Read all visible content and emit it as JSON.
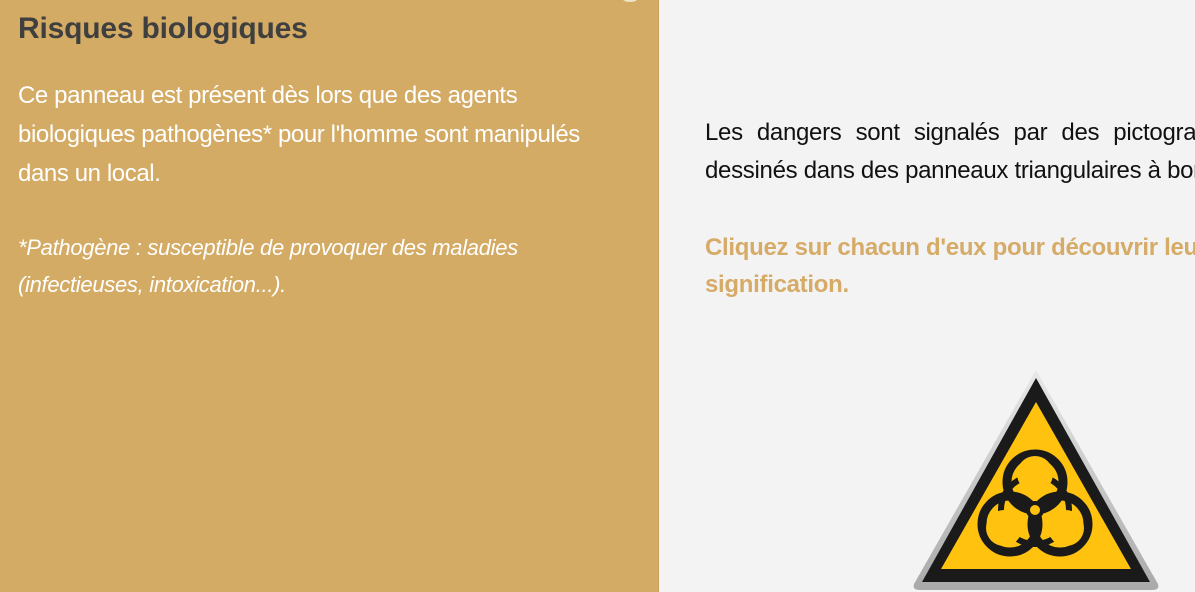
{
  "left_panel": {
    "title": "Risques biologiques",
    "description": "Ce panneau est présent dès lors que des agents biologiques pathogènes* pour l'homme sont manipulés dans un local.",
    "note": "*Pathogène : susceptible de provoquer des maladies (infectieuses, intoxication...).",
    "background_color": "#d3ab64"
  },
  "main": {
    "intro_text": "Les dangers sont signalés par des pictogrammes noirs dessinés dans des panneaux triangulaires à bord noir.",
    "instruction": "Cliquez sur chacun d'eux pour découvrir leur signification.",
    "accent_color": "#d6ab68"
  },
  "pictograms": [
    {
      "icon": "biohazard-icon",
      "sign_color": "#ffc20e",
      "border_color": "#111111"
    }
  ]
}
